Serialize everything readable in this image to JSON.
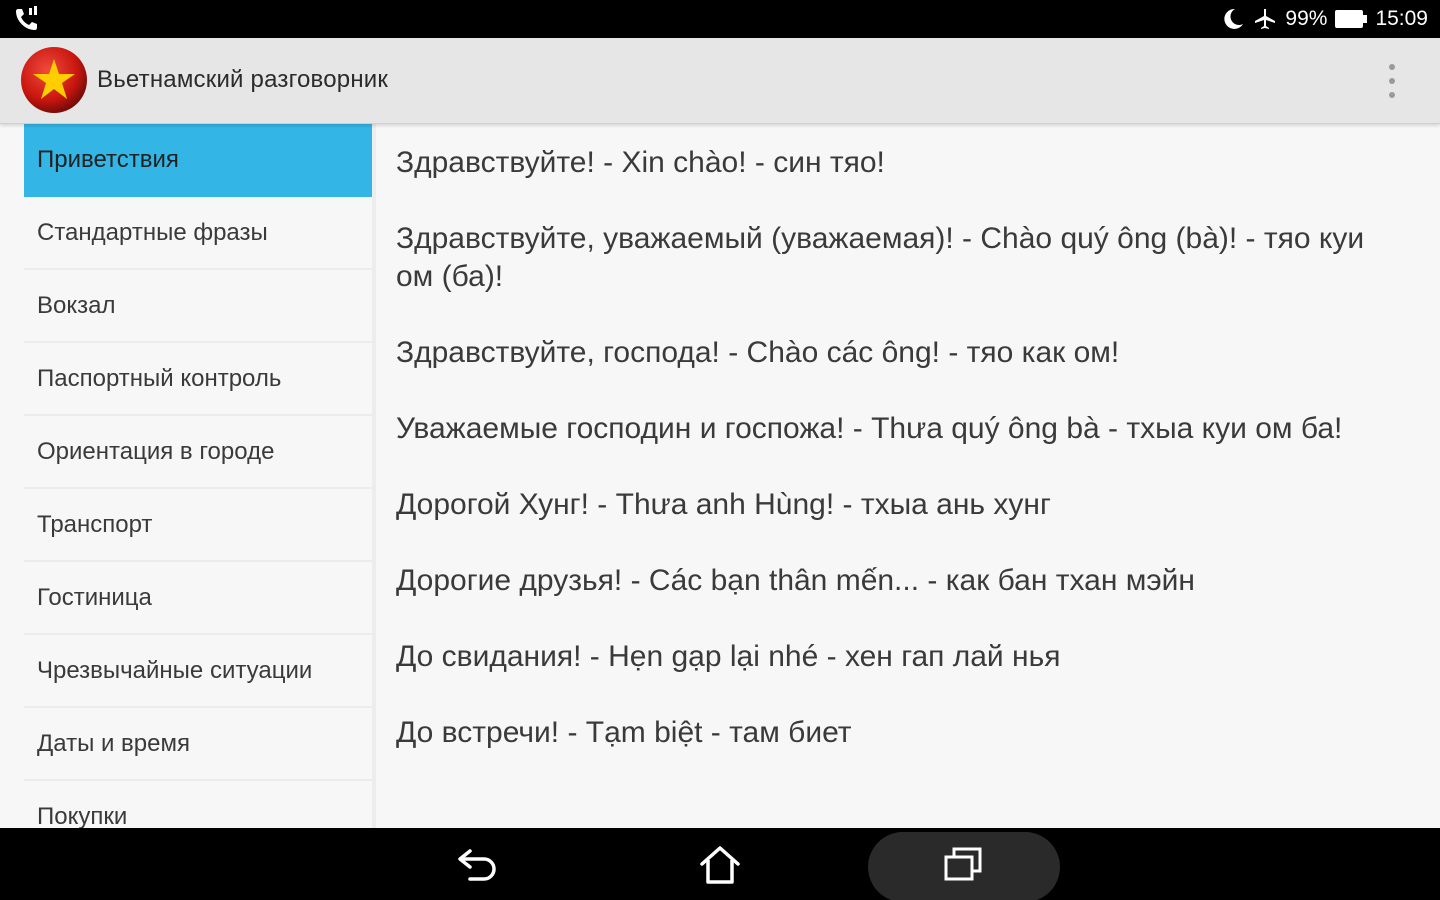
{
  "status_bar": {
    "left_icon": "phone-signal-icon",
    "icons": [
      "moon-icon",
      "airplane-icon"
    ],
    "battery_percent": "99%",
    "battery_icon": "battery-icon",
    "time": "15:09"
  },
  "app_bar": {
    "logo_icon": "vietnam-flag-icon",
    "title": "Вьетнамский разговорник",
    "menu_icon": "overflow-menu-icon"
  },
  "colors": {
    "accent": "#33b5e5",
    "flag_red": "#da251d",
    "flag_star": "#ffcd00"
  },
  "sidebar": {
    "items": [
      {
        "label": "Приветствия",
        "active": true
      },
      {
        "label": "Стандартные фразы"
      },
      {
        "label": "Вокзал"
      },
      {
        "label": "Паспортный контроль"
      },
      {
        "label": "Ориентация в городе"
      },
      {
        "label": "Транспорт"
      },
      {
        "label": "Гостиница"
      },
      {
        "label": "Чрезвычайные ситуации"
      },
      {
        "label": "Даты и время"
      },
      {
        "label": "Покупки"
      }
    ]
  },
  "phrases": [
    "Здравствуйте! - Xin chào! - син тяо!",
    "Здравствуйте, уважаемый (уважаемая)! - Chào quý ông (bà)! - тяо куи ом (ба)!",
    "Здравствуйте, господа! - Chào các ông! - тяо как ом!",
    "Уважаемые господин и госпожа! - Thưa quý ông bà - тхыа куи ом ба!",
    "Дорогой Хунг! - Thưa anh Hùng! - тхыа ань хунг",
    "Дорогие друзья! - Các bạn thân mến... - как бан тхан мэйн",
    "До свидания! - Hẹn gạp lại nhé - хен гап лай нья",
    "До встречи! - Tạm biệt - там биет"
  ],
  "nav_bar": {
    "back_icon": "back-icon",
    "home_icon": "home-icon",
    "recents_icon": "recents-icon"
  }
}
